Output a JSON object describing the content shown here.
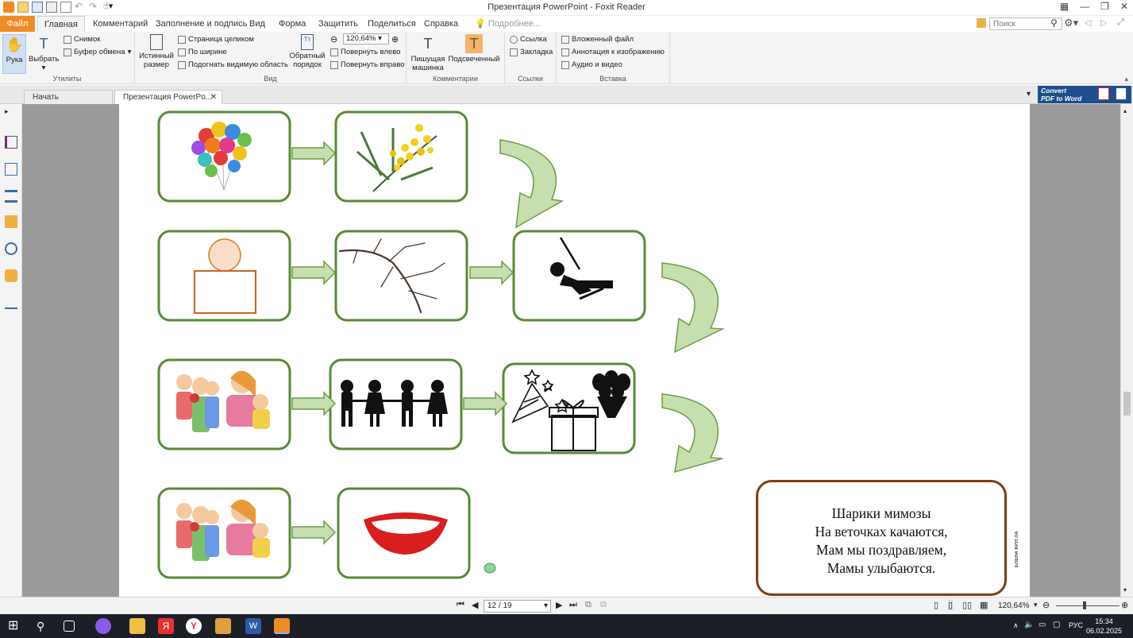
{
  "window": {
    "title": "Презентация PowerPoint - Foxit Reader"
  },
  "ribbon_tabs": {
    "file": "Файл",
    "home": "Главная",
    "comment": "Комментарий",
    "fill_sign": "Заполнение и подпись",
    "view": "Вид",
    "form": "Форма",
    "protect": "Защитить",
    "share": "Поделиться",
    "help": "Справка",
    "more": "Подробнее..."
  },
  "search": {
    "placeholder": "Поиск"
  },
  "ribbon": {
    "tools": {
      "hand": "Рука",
      "select": "Выбрать",
      "snapshot": "Снимок",
      "clipboard": "Буфер обмена",
      "label": "Утилиты"
    },
    "view": {
      "actual_size_1": "Истинный",
      "actual_size_2": "размер",
      "fit_page": "Страница целиком",
      "fit_width": "По ширине",
      "fit_visible": "Подогнать видимую область",
      "zoom_value": "120,64%",
      "rotate_left": "Повернуть влево",
      "rotate_right": "Повернуть вправо",
      "reverse_1": "Обратный",
      "reverse_2": "порядок",
      "label": "Вид"
    },
    "comments": {
      "typewriter_1": "Пишущая",
      "typewriter_2": "машинка",
      "highlight": "Подсвеченный",
      "label": "Комментарии"
    },
    "links": {
      "link": "Ссылка",
      "bookmark": "Закладка",
      "label": "Ссылки"
    },
    "insert": {
      "file_attachment": "Вложенный файл",
      "image_annotation": "Аннотация к изображению",
      "audio_video": "Аудио и видео",
      "label": "Вставка"
    }
  },
  "doc_tabs": {
    "start": "Начать",
    "current": "Презентация PowerPo..."
  },
  "convert_banner": {
    "line1": "Convert",
    "line2": "PDF to Word"
  },
  "poem": {
    "line1": "Шарики мимозы",
    "line2": "На веточках качаются,",
    "line3": "Мам мы поздравляем,",
    "line4": "Мамы улыбаются."
  },
  "author_mark": "ЕЛЕНА КРУГЛА",
  "statusbar": {
    "page": "12 / 19",
    "zoom": "120,64%"
  },
  "taskbar": {
    "lang": "РУС",
    "time": "15:34",
    "date": "06.02.2025"
  },
  "colors": {
    "card_border": "#5a8a34",
    "arrow_fill": "#c6dfae",
    "arrow_stroke": "#6f9a4a",
    "poem_border": "#7b3e13",
    "file_tab": "#f08a22"
  }
}
